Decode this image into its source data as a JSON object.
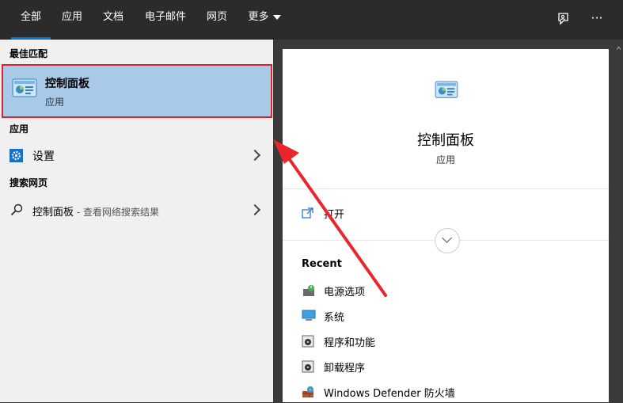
{
  "tabs": [
    {
      "label": "全部",
      "active": true
    },
    {
      "label": "应用"
    },
    {
      "label": "文档"
    },
    {
      "label": "电子邮件"
    },
    {
      "label": "网页"
    },
    {
      "label": "更多"
    }
  ],
  "toolbar": {
    "feedback_icon": "feedback-icon",
    "more_icon": "ellipsis-icon",
    "more_glyph": "···"
  },
  "left": {
    "best_match_heading": "最佳匹配",
    "best_match": {
      "title": "控制面板",
      "subtitle": "应用",
      "icon": "control-panel-icon"
    },
    "apps_heading": "应用",
    "apps": [
      {
        "label": "设置",
        "icon": "gear-icon"
      }
    ],
    "web_heading": "搜索网页",
    "web": [
      {
        "label": "控制面板",
        "hint": " - 查看网络搜索结果",
        "icon": "search-icon"
      }
    ]
  },
  "detail": {
    "title": "控制面板",
    "subtitle": "应用",
    "open_label": "打开",
    "recent_heading": "Recent",
    "recent": [
      {
        "label": "电源选项",
        "icon": "power-options-icon"
      },
      {
        "label": "系统",
        "icon": "system-icon"
      },
      {
        "label": "程序和功能",
        "icon": "programs-icon"
      },
      {
        "label": "卸载程序",
        "icon": "uninstall-icon"
      },
      {
        "label": "Windows Defender 防火墙",
        "icon": "firewall-icon"
      }
    ]
  },
  "colors": {
    "accent": "#0078d7",
    "selection": "#a9c9e8",
    "highlight_border": "#e0202a",
    "annotation_arrow": "#e8262b"
  }
}
